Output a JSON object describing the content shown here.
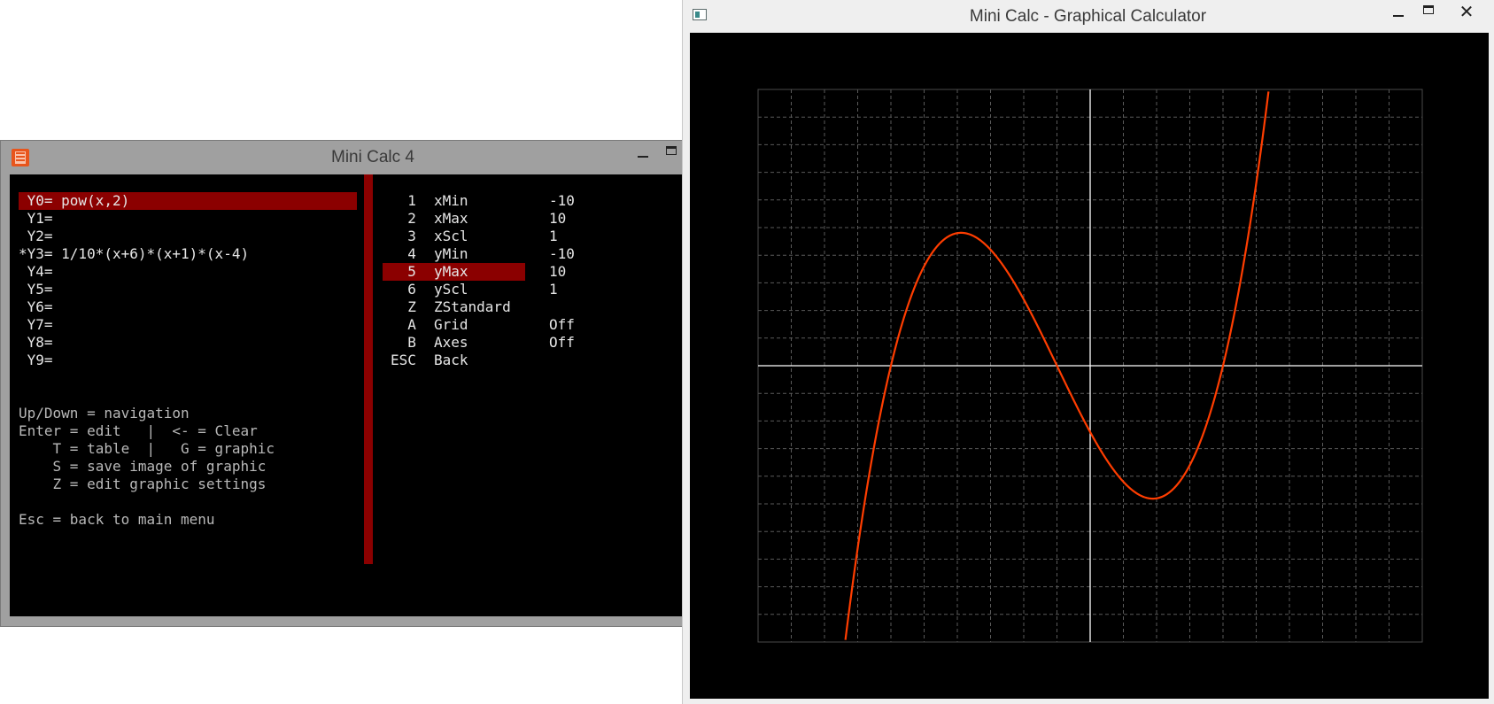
{
  "console": {
    "title": "Mini Calc 4",
    "close_glyph": "✕",
    "functions": [
      {
        "label": " Y0= pow(x,2)"
      },
      {
        "label": " Y1="
      },
      {
        "label": " Y2="
      },
      {
        "label": "*Y3= 1/10*(x+6)*(x+1)*(x-4)"
      },
      {
        "label": " Y4="
      },
      {
        "label": " Y5="
      },
      {
        "label": " Y6="
      },
      {
        "label": " Y7="
      },
      {
        "label": " Y8="
      },
      {
        "label": " Y9="
      }
    ],
    "help": [
      "Up/Down = navigation",
      "Enter = edit   |  <- = Clear",
      "    T = table  |   G = graphic",
      "    S = save image of graphic",
      "    Z = edit graphic settings",
      "",
      "Esc = back to main menu"
    ],
    "settings": [
      {
        "key": "  1",
        "name": "xMin",
        "value": "-10"
      },
      {
        "key": "  2",
        "name": "xMax",
        "value": "10"
      },
      {
        "key": "  3",
        "name": "xScl",
        "value": "1"
      },
      {
        "key": "  4",
        "name": "yMin",
        "value": "-10"
      },
      {
        "key": "  5",
        "name": "yMax",
        "value": "10"
      },
      {
        "key": "  6",
        "name": "yScl",
        "value": "1"
      },
      {
        "key": "  Z",
        "name": "ZStandard",
        "value": ""
      },
      {
        "key": "  A",
        "name": "Grid",
        "value": "Off"
      },
      {
        "key": "  B",
        "name": "Axes",
        "value": "Off"
      },
      {
        "key": "ESC",
        "name": "Back",
        "value": ""
      }
    ],
    "selected_function_index": 0,
    "selected_setting_index": 4
  },
  "graph_window": {
    "title": "Mini Calc - Graphical Calculator",
    "close_glyph": "✕",
    "colors": {
      "background": "#000000",
      "grid": "#5a5a5a",
      "axes": "#ffffff",
      "curve": "#ff3d00"
    }
  },
  "chart_data": {
    "type": "line",
    "title": "",
    "xlabel": "",
    "ylabel": "",
    "xlim": [
      -10,
      10
    ],
    "ylim": [
      -10,
      10
    ],
    "xscl": 1,
    "yscl": 1,
    "grid": true,
    "axes": true,
    "series": [
      {
        "expression": "1/10*(x+6)*(x+1)*(x-4)",
        "color": "#ff3d00"
      }
    ]
  }
}
